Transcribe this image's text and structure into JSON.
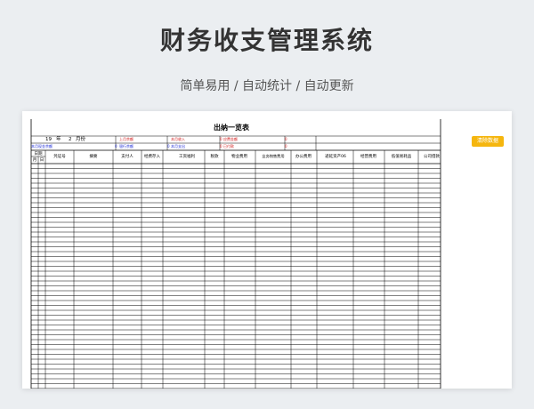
{
  "hero": {
    "title": "财务收支管理系统",
    "subtitle": "简单易用 / 自动统计 / 自动更新"
  },
  "sheet": {
    "title": "出纳一览表",
    "clear_button": "清除数据",
    "period": {
      "year": "19",
      "year_suffix": "年",
      "month": "2",
      "month_suffix": "月份"
    },
    "summary_row1": [
      {
        "label": "上月余额",
        "value": ""
      },
      {
        "label": "本月收入",
        "value": "0"
      },
      {
        "label": "应费金额",
        "value": "0"
      }
    ],
    "summary_row2": [
      {
        "label": "本月现金余额",
        "value": ""
      },
      {
        "label": "银行余额",
        "value": "0"
      },
      {
        "label": "本月支出",
        "value": "0"
      },
      {
        "label": "已付款",
        "value": "0"
      }
    ],
    "columns": [
      "日期",
      "凭证号",
      "摘要",
      "支付人",
      "经费存入",
      "工资福利",
      "税款",
      "物业费用",
      "业务物售费用",
      "办公费用",
      "递延资产06",
      "经营费用",
      "低值易耗品",
      "公司借款"
    ],
    "date_subcolumns": [
      "月",
      "日"
    ],
    "empty_rows": 46,
    "colors": {
      "accent": "#f5b60e",
      "label_blue": "#1c2bd6",
      "label_red": "#d01818",
      "grid": "#000000"
    }
  }
}
